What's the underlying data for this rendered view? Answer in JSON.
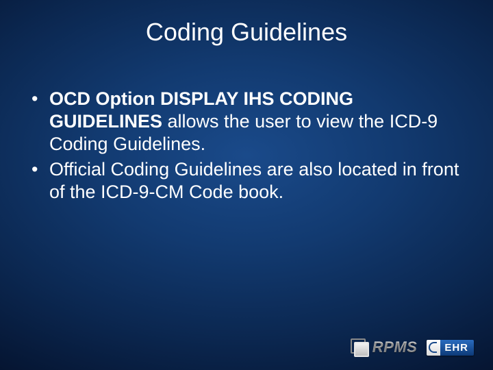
{
  "title": "Coding Guidelines",
  "bullets": [
    {
      "bold": "OCD Option DISPLAY IHS CODING GUIDELINES",
      "rest": " allows the user to view the ICD-9 Coding Guidelines."
    },
    {
      "bold": "",
      "rest": "Official Coding Guidelines are also located in front of the ICD-9-CM Code book."
    }
  ],
  "footer": {
    "rpms": "RPMS",
    "ehr": "EHR"
  }
}
